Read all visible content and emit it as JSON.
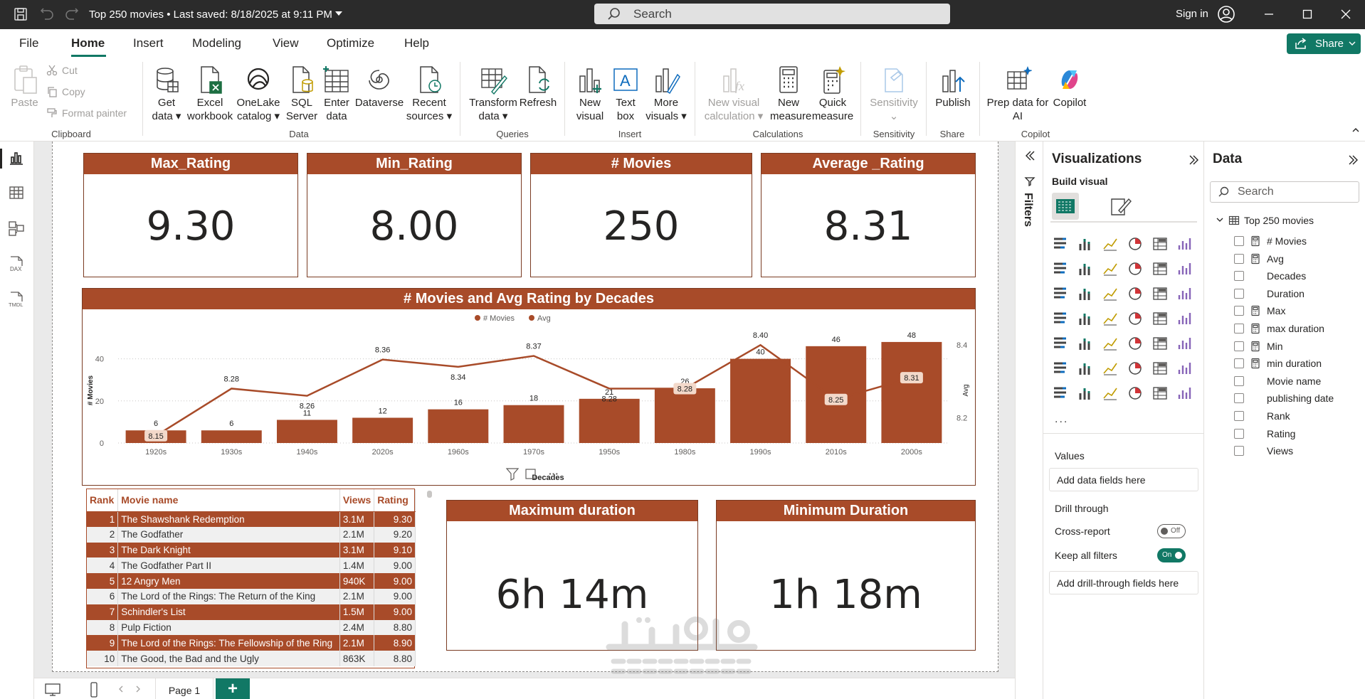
{
  "titlebar": {
    "doc_title": "Top 250 movies • Last saved: 8/18/2025 at 9:11 PM",
    "search_placeholder": "Search",
    "sign_in": "Sign in"
  },
  "menu": {
    "tabs": [
      "File",
      "Home",
      "Insert",
      "Modeling",
      "View",
      "Optimize",
      "Help"
    ],
    "active": "Home",
    "share_label": "Share"
  },
  "ribbon": {
    "clipboard": {
      "paste": "Paste",
      "cut": "Cut",
      "copy": "Copy",
      "format_painter": "Format painter",
      "group": "Clipboard"
    },
    "data": {
      "get_data": [
        "Get",
        "data"
      ],
      "excel": [
        "Excel",
        "workbook"
      ],
      "onelake": [
        "OneLake",
        "catalog"
      ],
      "sql": [
        "SQL",
        "Server"
      ],
      "enter": [
        "Enter",
        "data"
      ],
      "dataverse": [
        "Dataverse",
        ""
      ],
      "recent": [
        "Recent",
        "sources"
      ],
      "group": "Data"
    },
    "queries": {
      "transform": [
        "Transform",
        "data"
      ],
      "refresh": [
        "Refresh",
        ""
      ],
      "group": "Queries"
    },
    "insert": {
      "new_visual": [
        "New",
        "visual"
      ],
      "text_box": [
        "Text",
        "box"
      ],
      "more_visuals": [
        "More",
        "visuals"
      ],
      "group": "Insert"
    },
    "calculations": {
      "new_visual_calc": [
        "New visual",
        "calculation"
      ],
      "new_measure": [
        "New",
        "measure"
      ],
      "quick_measure": [
        "Quick",
        "measure"
      ],
      "group": "Calculations"
    },
    "sensitivity": {
      "label": [
        "Sensitivity",
        ""
      ],
      "group": "Sensitivity"
    },
    "share": {
      "publish": [
        "Publish",
        ""
      ],
      "group": "Share"
    },
    "copilot": {
      "prep": [
        "Prep data for",
        "AI"
      ],
      "copilot": [
        "Copilot",
        ""
      ],
      "group": "Copilot"
    }
  },
  "kpis": [
    {
      "title": "Max_Rating",
      "value": "9.30"
    },
    {
      "title": "Min_Rating",
      "value": "8.00"
    },
    {
      "title": "# Movies",
      "value": "250"
    },
    {
      "title": "Average _Rating",
      "value": "8.31"
    }
  ],
  "duration_cards": [
    {
      "title": "Maximum duration",
      "value": "6h 14m"
    },
    {
      "title": "Minimum Duration",
      "value": "1h 18m"
    }
  ],
  "chart_data": {
    "type": "bar",
    "title": "# Movies and Avg Rating by Decades",
    "legend": [
      "# Movies",
      "Avg"
    ],
    "legend_position": "top-center",
    "xlabel": "Decades",
    "ylabel": "# Movies",
    "y2label": "Avg",
    "categories": [
      "1920s",
      "1930s",
      "1940s",
      "2020s",
      "1960s",
      "1970s",
      "1950s",
      "1980s",
      "1990s",
      "2010s",
      "2000s"
    ],
    "series": [
      {
        "name": "# Movies",
        "type": "bar",
        "values": [
          6,
          6,
          11,
          12,
          16,
          18,
          21,
          26,
          40,
          46,
          48
        ]
      },
      {
        "name": "Avg",
        "type": "line",
        "axis": "secondary",
        "values": [
          8.15,
          8.28,
          8.26,
          8.36,
          8.34,
          8.37,
          8.28,
          8.28,
          8.4,
          8.25,
          8.31
        ]
      }
    ],
    "y_ticks": [
      0,
      20,
      40
    ],
    "y2_ticks": [
      8.2,
      8.4
    ],
    "ylim": [
      0,
      50
    ],
    "y2lim": [
      8.13,
      8.42
    ],
    "grid": true,
    "colors": {
      "bar": "#a84b29",
      "line": "#a84b29"
    }
  },
  "table": {
    "columns": [
      "Rank",
      "Movie name",
      "Views",
      "Rating"
    ],
    "rows": [
      [
        "1",
        "The Shawshank Redemption",
        "3.1M",
        "9.30"
      ],
      [
        "2",
        "The Godfather",
        "2.1M",
        "9.20"
      ],
      [
        "3",
        "The Dark Knight",
        "3.1M",
        "9.10"
      ],
      [
        "4",
        "The Godfather Part II",
        "1.4M",
        "9.00"
      ],
      [
        "5",
        "12 Angry Men",
        "940K",
        "9.00"
      ],
      [
        "6",
        "The Lord of the Rings: The Return of the King",
        "2.1M",
        "9.00"
      ],
      [
        "7",
        "Schindler's List",
        "1.5M",
        "9.00"
      ],
      [
        "8",
        "Pulp Fiction",
        "2.4M",
        "8.80"
      ],
      [
        "9",
        "The Lord of the Rings: The Fellowship of the Ring",
        "2.1M",
        "8.90"
      ],
      [
        "10",
        "The Good, the Bad and the Ugly",
        "863K",
        "8.80"
      ]
    ]
  },
  "filters": {
    "label": "Filters"
  },
  "visualizations": {
    "title": "Visualizations",
    "build_visual": "Build visual",
    "values_label": "Values",
    "values_placeholder": "Add data fields here",
    "drill_through": "Drill through",
    "cross_report": "Cross-report",
    "cross_report_state": "Off",
    "keep_filters": "Keep all filters",
    "keep_filters_state": "On",
    "drill_placeholder": "Add drill-through fields here",
    "more": "..."
  },
  "data_pane": {
    "title": "Data",
    "search_placeholder": "Search",
    "table_name": "Top 250 movies",
    "fields": [
      {
        "name": "# Movies",
        "calc": true
      },
      {
        "name": "Avg",
        "calc": true
      },
      {
        "name": "Decades",
        "calc": false
      },
      {
        "name": "Duration",
        "calc": false
      },
      {
        "name": "Max",
        "calc": true
      },
      {
        "name": "max duration",
        "calc": true
      },
      {
        "name": "Min",
        "calc": true
      },
      {
        "name": "min duration",
        "calc": true
      },
      {
        "name": "Movie name",
        "calc": false
      },
      {
        "name": "publishing date",
        "calc": false
      },
      {
        "name": "Rank",
        "calc": false
      },
      {
        "name": "Rating",
        "calc": false
      },
      {
        "name": "Views",
        "calc": false
      }
    ]
  },
  "pages": {
    "current": "Page 1",
    "add": "+"
  },
  "watermark": {
    "arabic": "مستقل",
    "latin": "mostaql.com"
  },
  "colors": {
    "accent": "#a84b29",
    "brand": "#117865"
  }
}
